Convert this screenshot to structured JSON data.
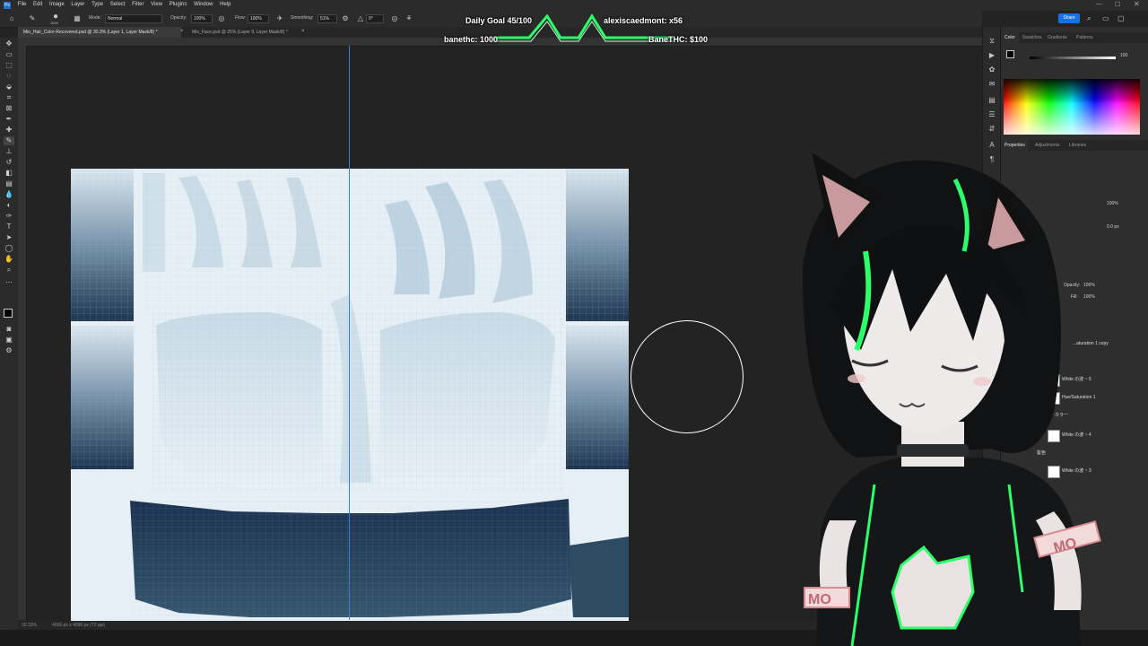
{
  "menu": [
    "File",
    "Edit",
    "Image",
    "Layer",
    "Type",
    "Select",
    "Filter",
    "View",
    "Plugins",
    "Window",
    "Help"
  ],
  "options_bar": {
    "mode_label": "Mode:",
    "mode_value": "Normal",
    "opacity_label": "Opacity:",
    "opacity_value": "100%",
    "flow_label": "Flow:",
    "flow_value": "100%",
    "smoothing_label": "Smoothing:",
    "smoothing_value": "51%",
    "angle_value": "0°",
    "brush_size": "1000"
  },
  "share_label": "Share",
  "tabs": [
    {
      "label": "Mio_Hair_Color-Recovered.psd @ 30.3% (Layer 1, Layer Mask/8) *",
      "active": true
    },
    {
      "label": "Mio_Face.psd @ 25% (Layer 9, Layer Mask/8) *",
      "active": false
    }
  ],
  "status": {
    "zoom": "30.33%",
    "doc": "4096 px x 4096 px (72 ppi)"
  },
  "overlay": {
    "daily_goal": "Daily Goal 45/100",
    "top_user": "alexiscaedmont: x56",
    "left_stat": "banethc: 1000",
    "right_stat": "BaneTHC: $100"
  },
  "panels": {
    "color_tabs": [
      "Color",
      "Swatches",
      "Gradients",
      "Patterns"
    ],
    "props_tabs": [
      "Properties",
      "Adjustments",
      "Libraries"
    ],
    "opacity_label": "Opacity:",
    "opacity_value": "100%",
    "fill_label": "Fill:",
    "fill_value": "100%",
    "value_100": "100%",
    "value_px": "0.0 px",
    "value_hundred": "100"
  },
  "layers": [
    {
      "name": "...aturation 1 copy"
    },
    {
      "name": "White の波 ~ 5"
    },
    {
      "name": "Hue/Saturation 1"
    },
    {
      "name": "インナーカラー"
    },
    {
      "name": "White の波 ~ 4"
    },
    {
      "name": "髪色"
    },
    {
      "name": "White の波 ~ 3"
    }
  ],
  "avatar_badge_text": "MO",
  "colors": {
    "accent_green": "#2bff6a",
    "guide_blue": "#3b7fd4",
    "share_blue": "#1473e6"
  }
}
